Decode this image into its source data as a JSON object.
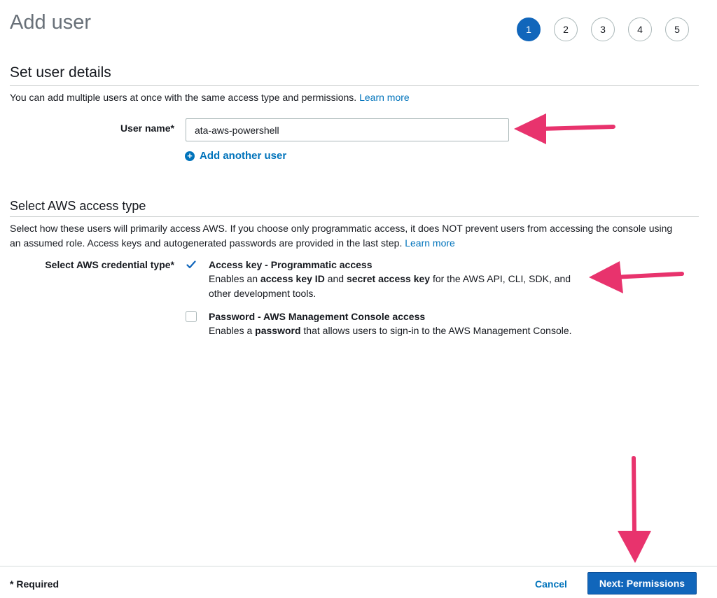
{
  "page": {
    "title": "Add user"
  },
  "steps": [
    "1",
    "2",
    "3",
    "4",
    "5"
  ],
  "user_details": {
    "heading": "Set user details",
    "description": "You can add multiple users at once with the same access type and permissions.",
    "learn_more": "Learn more",
    "user_name_label": "User name*",
    "user_name_value": "ata-aws-powershell",
    "add_another_user": "Add another user"
  },
  "access_type": {
    "heading": "Select AWS access type",
    "description_line1": "Select how these users will primarily access AWS. If you choose only programmatic access, it does NOT prevent users from accessing the console using",
    "description_line2": "an assumed role. Access keys and autogenerated passwords are provided in the last step.",
    "learn_more": "Learn more",
    "credential_label": "Select AWS credential type*",
    "options": [
      {
        "title": "Access key - Programmatic access",
        "checked": true,
        "desc_1": "Enables an ",
        "desc_2": "access key ID",
        "desc_3": " and ",
        "desc_4": "secret access key",
        "desc_5": " for the AWS API, CLI, SDK, and",
        "desc_6": "other development tools."
      },
      {
        "title": "Password - AWS Management Console access",
        "checked": false,
        "desc_1": "Enables a ",
        "desc_2": "password",
        "desc_3": " that allows users to sign-in to the AWS Management Console."
      }
    ]
  },
  "footer": {
    "required": "* Required",
    "cancel": "Cancel",
    "next": "Next: Permissions"
  },
  "colors": {
    "primary": "#1166bb",
    "link": "#0073bb",
    "annotation_arrow": "#e8336d"
  },
  "icons": [
    "plus-circle-icon",
    "checkmark-icon",
    "arrow-annotation-icon"
  ]
}
